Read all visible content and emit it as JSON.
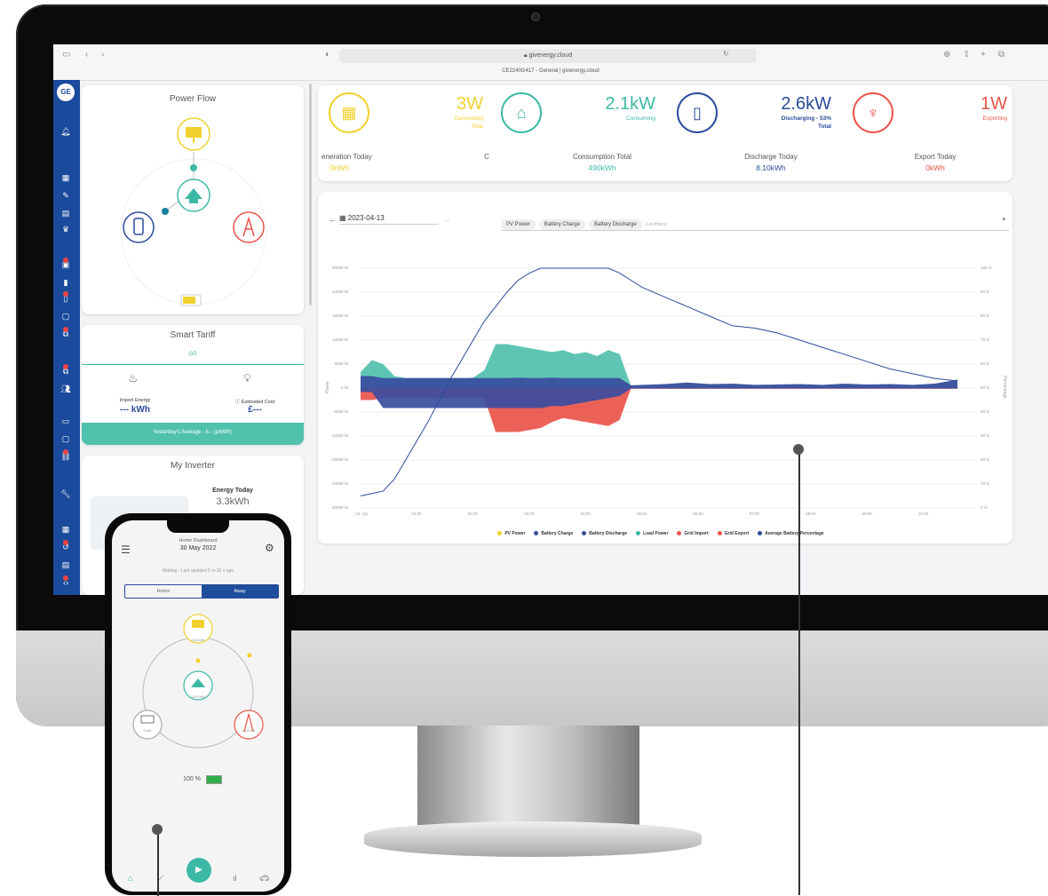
{
  "browser": {
    "url": "givenergy.cloud",
    "tab_title": "CE2240G417 - General | givenergy.cloud"
  },
  "sidebar": {
    "logo": "GE"
  },
  "power_flow": {
    "title": "Power Flow"
  },
  "smart_tariff": {
    "title": "Smart Tariff",
    "tariff_name": "GO",
    "import_label": "Import Energy",
    "import_value": "--- kWh",
    "cost_label": "Estimated Cost",
    "cost_value": "£---",
    "footer": "Yesterday's Average - £-- (p/kWh)"
  },
  "my_inverter": {
    "title": "My Inverter",
    "energy_label": "Energy Today",
    "energy_value": "3.3kWh"
  },
  "stats": [
    {
      "value": "3W",
      "label": "Generating",
      "sub": "Total",
      "color": "#f1d12e",
      "icon": "solar-panel-icon"
    },
    {
      "value": "2.1kW",
      "label": "Consuming",
      "sub": "",
      "color": "#3cb9a4",
      "icon": "house-icon"
    },
    {
      "value": "2.6kW",
      "label": "Discharging - 53%",
      "sub": "Total",
      "color": "#2a4b9b",
      "icon": "battery-icon"
    },
    {
      "value": "1W",
      "label": "Exporting",
      "sub": "",
      "color": "#e9544a",
      "icon": "pylon-icon"
    }
  ],
  "totals": [
    {
      "label": "eneration Today",
      "value": "0kWh",
      "color": "#f1d12e"
    },
    {
      "label": "C",
      "value": "",
      "color": "#999"
    },
    {
      "label": "Consumption Total",
      "value": "490kWh",
      "color": "#3cb9a4"
    },
    {
      "label": "Discharge Today",
      "value": "8.10kWh",
      "color": "#2a4b9b"
    },
    {
      "label": "Export Today",
      "value": "0kWh",
      "color": "#e9544a"
    }
  ],
  "chart_controls": {
    "date": "2023-04-13",
    "filters": [
      "PV Power",
      "Battery Charge",
      "Battery Discharge"
    ],
    "more": "(+4 others)"
  },
  "chart_data": {
    "type": "area",
    "ylabel": "Power",
    "y2label": "Percentage",
    "y_ticks": [
      "30000 W",
      "24000 W",
      "18000 W",
      "12000 W",
      "6000 W",
      "0 W",
      "-6000 W",
      "-12000 W",
      "-18000 W",
      "-24000 W",
      "-30000 W"
    ],
    "y2_ticks": [
      "100 %",
      "90 %",
      "80 %",
      "70 %",
      "60 %",
      "50 %",
      "40 %",
      "30 %",
      "20 %",
      "10 %",
      "0 %"
    ],
    "x_ticks": [
      "13. Apr",
      "01:00",
      "02:00",
      "03:00",
      "04:00",
      "05:00",
      "06:00",
      "07:00",
      "08:00",
      "09:00",
      "10:00"
    ],
    "ylim": [
      -30000,
      30000
    ],
    "y2lim": [
      0,
      100
    ],
    "x": [
      0,
      0.2,
      0.4,
      0.6,
      0.8,
      1.0,
      1.2,
      1.4,
      1.6,
      1.8,
      2.0,
      2.2,
      2.4,
      2.6,
      2.8,
      3.0,
      3.2,
      3.4,
      3.6,
      3.8,
      4.0,
      4.2,
      4.4,
      4.6,
      4.8,
      5.0,
      5.4,
      5.8,
      6.2,
      6.6,
      7.0,
      7.4,
      7.8,
      8.2,
      8.6,
      9.0,
      9.4,
      9.8,
      10.2,
      10.6
    ],
    "series": [
      {
        "name": "Load Power",
        "color": "#52bfae",
        "values": [
          4000,
          7000,
          6000,
          3000,
          2500,
          2500,
          2500,
          2500,
          2500,
          2500,
          2600,
          4500,
          11000,
          11000,
          10500,
          10000,
          9500,
          9000,
          9500,
          8500,
          9000,
          8000,
          9500,
          8500,
          600,
          700,
          900,
          1200,
          800,
          1000,
          700,
          800,
          900,
          700,
          1000,
          800,
          900,
          700,
          1000,
          2000
        ]
      },
      {
        "name": "Battery Discharge",
        "color": "#3a4da0",
        "values": [
          3000,
          3000,
          2500,
          2500,
          2500,
          2500,
          2500,
          2500,
          2500,
          2500,
          2500,
          2500,
          2500,
          2500,
          2600,
          2500,
          2500,
          2600,
          2500,
          2500,
          2500,
          2500,
          2500,
          2500,
          700,
          800,
          1000,
          1400,
          1000,
          1100,
          800,
          900,
          1000,
          800,
          1100,
          900,
          1000,
          800,
          1100,
          2100
        ]
      },
      {
        "name": "Grid Import",
        "color": "#e9544a",
        "values": [
          -3000,
          -3000,
          -2500,
          -2500,
          -2500,
          -2500,
          -2500,
          -2500,
          -2500,
          -2500,
          -2500,
          -2500,
          -11000,
          -11000,
          -11000,
          -10500,
          -10000,
          -8500,
          -7500,
          -8000,
          -8500,
          -9000,
          -9500,
          -8000,
          -200,
          -200,
          -200,
          -200,
          -200,
          -200,
          -200,
          -200,
          -200,
          -200,
          -200,
          -200,
          -200,
          -200,
          -200,
          -200
        ]
      },
      {
        "name": "Battery Charge",
        "color": "#3a4da0",
        "values": [
          -1000,
          -1000,
          -5000,
          -5000,
          -5000,
          -5000,
          -5000,
          -5000,
          -5000,
          -5000,
          -5000,
          -5000,
          -5000,
          -5000,
          -5000,
          -5000,
          -5000,
          -4500,
          -4500,
          -4000,
          -3500,
          -3000,
          -2500,
          -2000,
          -100,
          -100,
          -100,
          -100,
          -100,
          -100,
          -100,
          -100,
          -100,
          -100,
          -100,
          -100,
          -100,
          -100,
          -100,
          -100
        ]
      },
      {
        "name": "Average Battery Percentage",
        "color": "#2a4b9b",
        "axis": "right",
        "values": [
          5,
          6,
          7,
          12,
          20,
          28,
          36,
          45,
          54,
          62,
          70,
          78,
          84,
          90,
          95,
          98,
          100,
          100,
          100,
          100,
          100,
          100,
          100,
          98,
          95,
          92,
          88,
          84,
          80,
          76,
          75,
          73,
          70,
          67,
          64,
          61,
          58,
          56,
          54,
          53
        ]
      },
      {
        "name": "PV Power",
        "color": "#f1d12e",
        "values": []
      },
      {
        "name": "Grid Export",
        "color": "#e9544a",
        "values": []
      }
    ]
  },
  "legend": [
    {
      "label": "PV Power",
      "color": "#f1d12e"
    },
    {
      "label": "Battery Charge",
      "color": "#3a4da0"
    },
    {
      "label": "Battery Discharge",
      "color": "#3a4da0"
    },
    {
      "label": "Load Power",
      "color": "#3cb9a4"
    },
    {
      "label": "Grid Import",
      "color": "#e9544a"
    },
    {
      "label": "Grid Export",
      "color": "#e9544a"
    },
    {
      "label": "Average Battery Percentage",
      "color": "#2a4b9b"
    }
  ],
  "phone": {
    "title": "Home Dashboard",
    "date": "30 May 2022",
    "status": "Waiting - Last updated 5 m 32 s ago",
    "toggle_home": "Home",
    "toggle_away": "Away",
    "solar_value": "0.24 kW",
    "home_value": "0.07 kW",
    "battery_value": "0 kW",
    "grid_value": "0.16 kW",
    "battery_percent": "100 %"
  }
}
